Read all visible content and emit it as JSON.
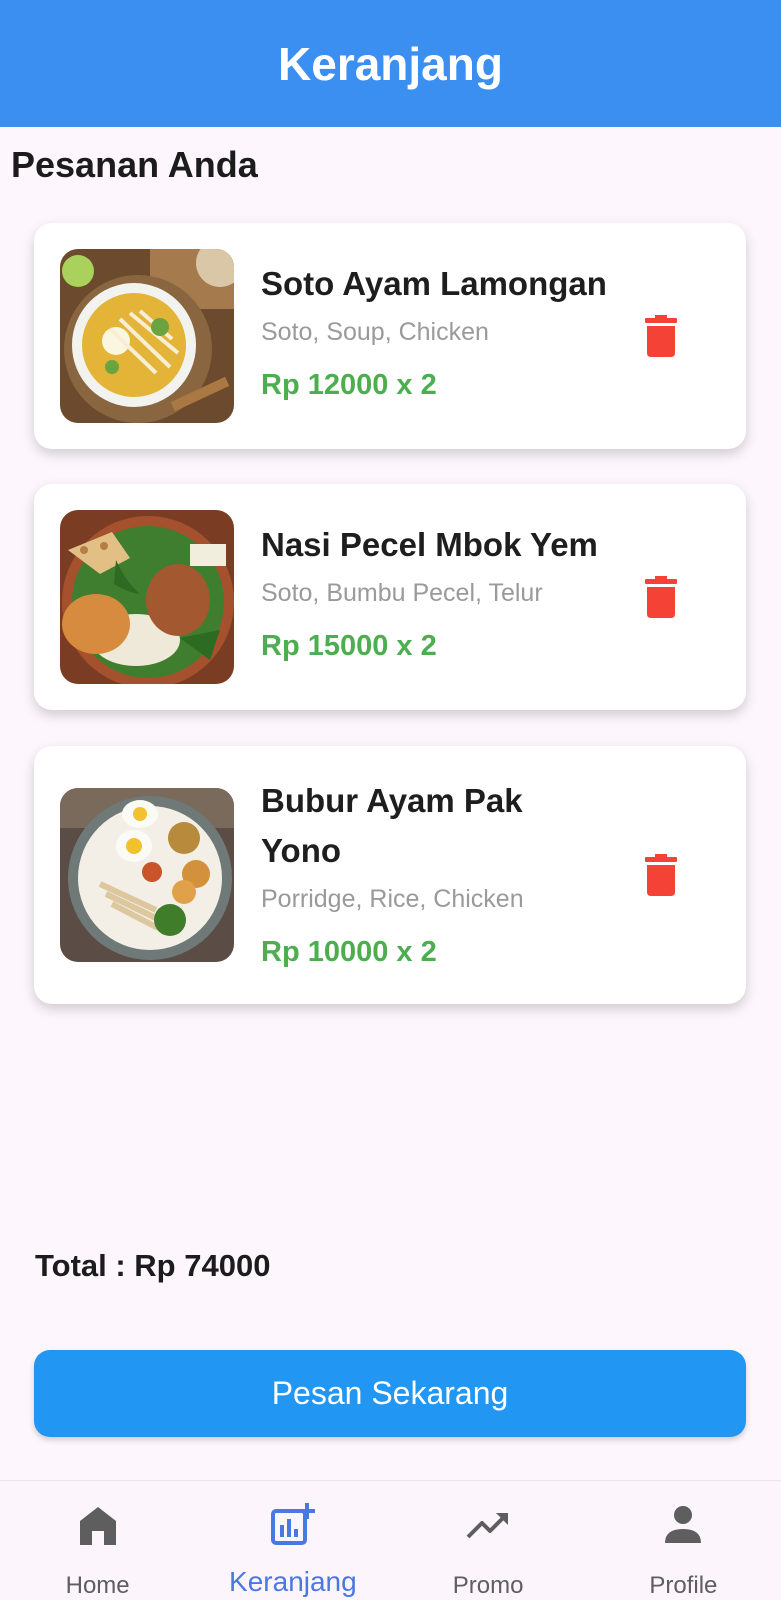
{
  "appbar": {
    "title": "Keranjang"
  },
  "section": {
    "title": "Pesanan Anda"
  },
  "cart_items": [
    {
      "name": "Soto Ayam Lamongan",
      "tags": "Soto, Soup, Chicken",
      "price": "Rp 12000 x 2"
    },
    {
      "name": "Nasi Pecel Mbok Yem",
      "tags": "Soto, Bumbu Pecel, Telur",
      "price": "Rp 15000 x 2"
    },
    {
      "name": "Bubur Ayam Pak Yono",
      "tags": "Porridge, Rice, Chicken",
      "price": "Rp 10000 x 2"
    }
  ],
  "summary": {
    "total": "Total : Rp 74000"
  },
  "order_button": {
    "label": "Pesan Sekarang"
  },
  "bottom_nav": {
    "items": [
      {
        "label": "Home",
        "icon": "home-icon"
      },
      {
        "label": "Keranjang",
        "icon": "cart-chart-icon"
      },
      {
        "label": "Promo",
        "icon": "trending-up-icon"
      },
      {
        "label": "Profile",
        "icon": "person-icon"
      }
    ],
    "active_index": 1
  },
  "colors": {
    "appbar": "#3a8ff0",
    "price": "#4cae4f",
    "delete": "#f44336",
    "button": "#2196f3",
    "nav_active": "#4a78e2",
    "nav_inactive": "#5e5e5e"
  }
}
